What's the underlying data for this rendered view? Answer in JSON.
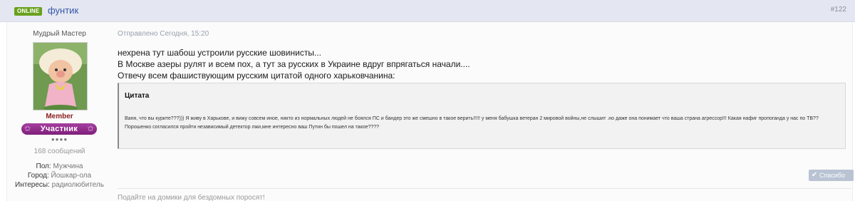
{
  "header": {
    "online_label": "ONLINE",
    "author": "фунтик",
    "post_number": "#122"
  },
  "author_panel": {
    "title": "Мудрый Мастер",
    "group": "Member",
    "rank_label": "Участник",
    "rep_dots": "●●●●",
    "post_count": "168 сообщений",
    "info": [
      {
        "key": "Пол:",
        "value": "Мужчина"
      },
      {
        "key": "Город:",
        "value": "Йошкар-ола"
      },
      {
        "key": "Интересы:",
        "value": "радиолюбитель"
      }
    ]
  },
  "post": {
    "posted": "Отправлено Сегодня, 15:20",
    "lines": [
      "нехрена тут шабош устроили русские шовинисты...",
      "В Москве азеры рулят и всем пох, а тут за русских в Украине вдруг впрягаться начали....",
      "Отвечу всем фашиствующим русским цитатой одного харьковчанина:"
    ],
    "quote": {
      "title": "Цитата",
      "text": "Ваня, что вы курите???))) Я живу в Харькове, и вижу совсем иное, никто из нормальных людей не боялся ПС и бандер это же смешно в такое верить!!!!! у меня бабушка ветеран 2 мировой войны,не слышит .но даже она понимает что ваша страна агрессор!!! Какая нафиг пропоганда у нас по ТВ?? Порошенко согласился пройти независимый детектор лжи,мне интересно ваш Путин бы пошел на такое????"
    },
    "thanks_label": "Спасибо",
    "signature": "Подайте на домики для бездомных поросят!"
  },
  "colors": {
    "header_bg": "#e4e7f1",
    "online_badge": "#6aa11d",
    "author_link": "#3355aa",
    "group_name": "#8a1f1f",
    "rank_badge": "#8e2b8a",
    "thanks_button": "#b9c3d3"
  }
}
